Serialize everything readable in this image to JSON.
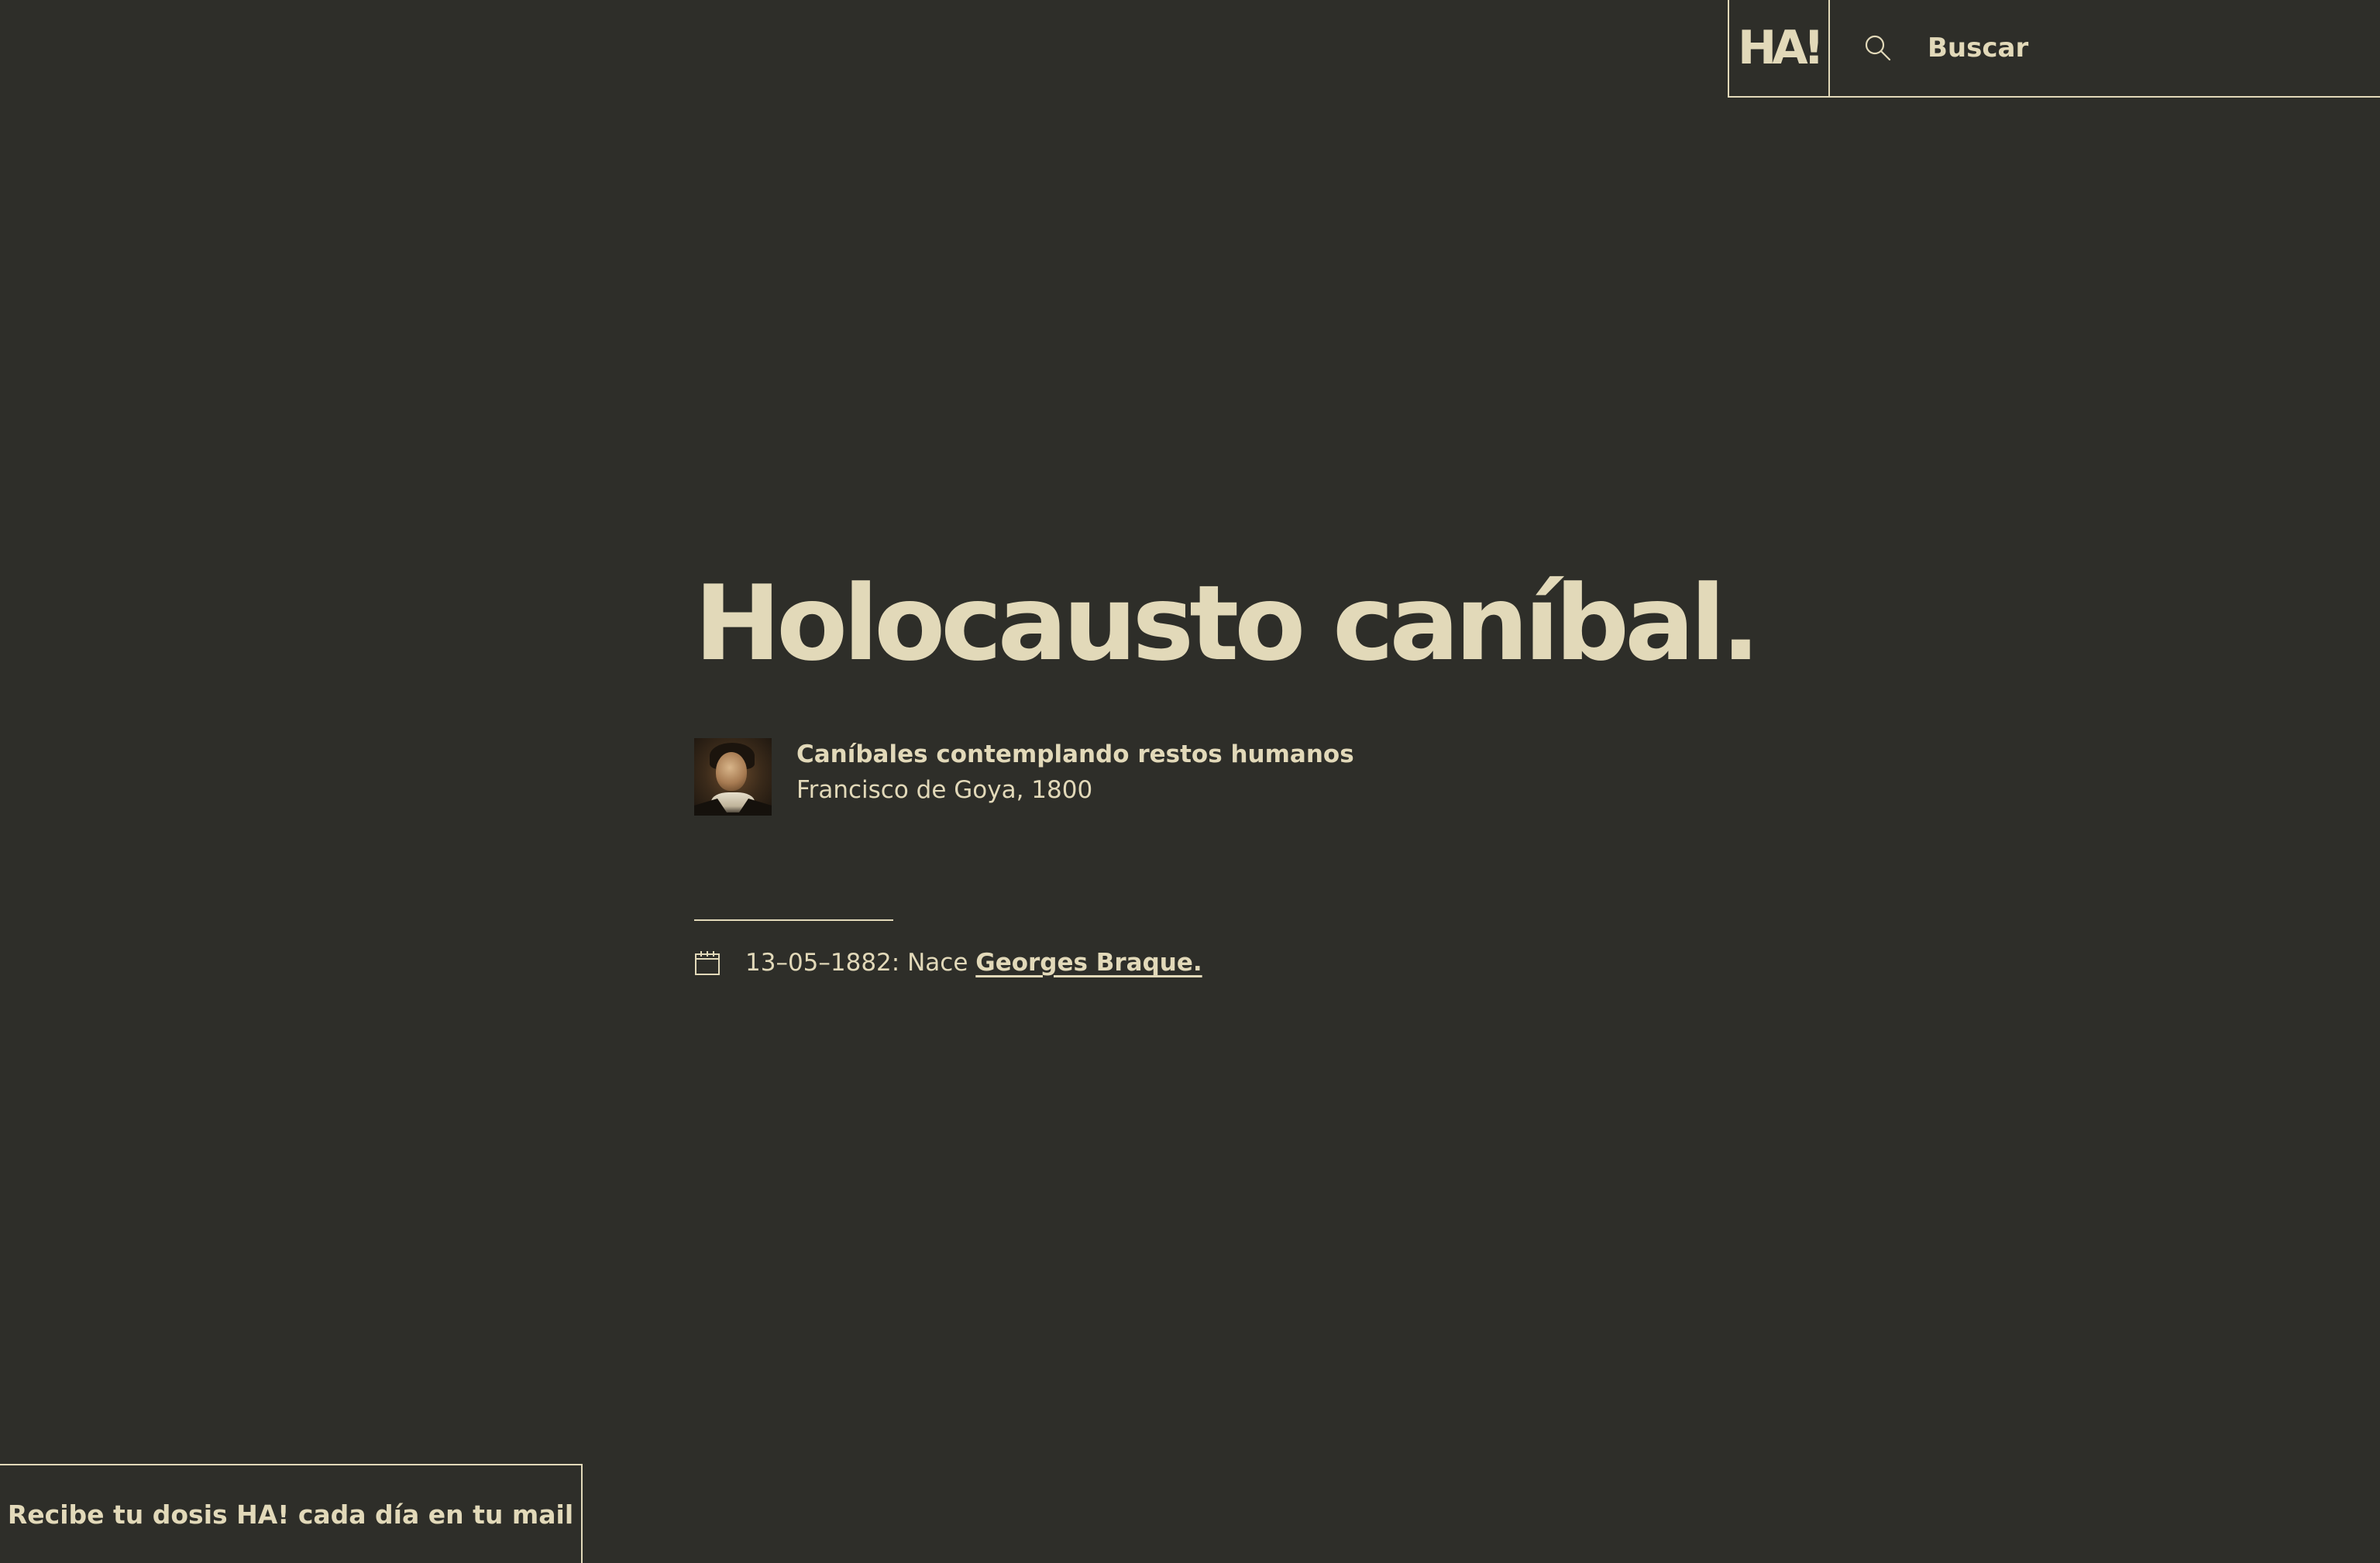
{
  "header": {
    "logo_text": "HA!",
    "search_label": "Buscar",
    "search_icon": "search-icon"
  },
  "main": {
    "title": "Holocausto caníbal.",
    "artwork": {
      "name": "Caníbales contemplando restos humanos",
      "meta": "Francisco de Goya, 1800",
      "thumbnail": "artist-portrait-thumbnail"
    },
    "event": {
      "icon": "calendar-icon",
      "prefix": "13–05–1882: Nace",
      "link_label": "Georges Braque."
    }
  },
  "footer": {
    "newsletter_label": "Recibe tu dosis HA! cada día en tu mail"
  },
  "colors": {
    "background": "#2e2e29",
    "foreground": "#e2d9b9"
  }
}
